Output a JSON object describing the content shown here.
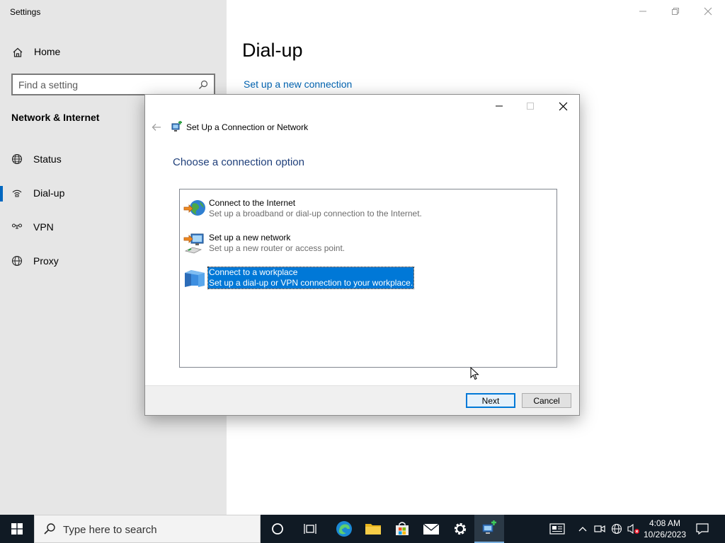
{
  "settings": {
    "app_title": "Settings",
    "home_label": "Home",
    "search_placeholder": "Find a setting",
    "section_title": "Network & Internet",
    "nav_items": [
      {
        "label": "Status",
        "icon": "globe-icon"
      },
      {
        "label": "Dial-up",
        "icon": "dialup-icon",
        "selected": true
      },
      {
        "label": "VPN",
        "icon": "vpn-icon"
      },
      {
        "label": "Proxy",
        "icon": "globe-icon"
      }
    ],
    "page_title": "Dial-up",
    "setup_link": "Set up a new connection",
    "accent_color": "#0067c0"
  },
  "dialog": {
    "title": "Set Up a Connection or Network",
    "heading": "Choose a connection option",
    "options": [
      {
        "title": "Connect to the Internet",
        "description": "Set up a broadband or dial-up connection to the Internet.",
        "icon": "internet-globe-icon"
      },
      {
        "title": "Set up a new network",
        "description": "Set up a new router or access point.",
        "icon": "new-network-icon"
      },
      {
        "title": "Connect to a workplace",
        "description": "Set up a dial-up or VPN connection to your workplace.",
        "icon": "workplace-icon",
        "selected": true
      }
    ],
    "next_label": "Next",
    "cancel_label": "Cancel",
    "selection_color": "#0078d7"
  },
  "taskbar": {
    "search_placeholder": "Type here to search",
    "apps": [
      "task-view-icon",
      "edge-icon",
      "file-explorer-icon",
      "store-icon",
      "mail-icon",
      "settings-gear-icon",
      "network-wizard-icon"
    ],
    "clock_time": "4:08 AM",
    "clock_date": "10/26/2023"
  }
}
